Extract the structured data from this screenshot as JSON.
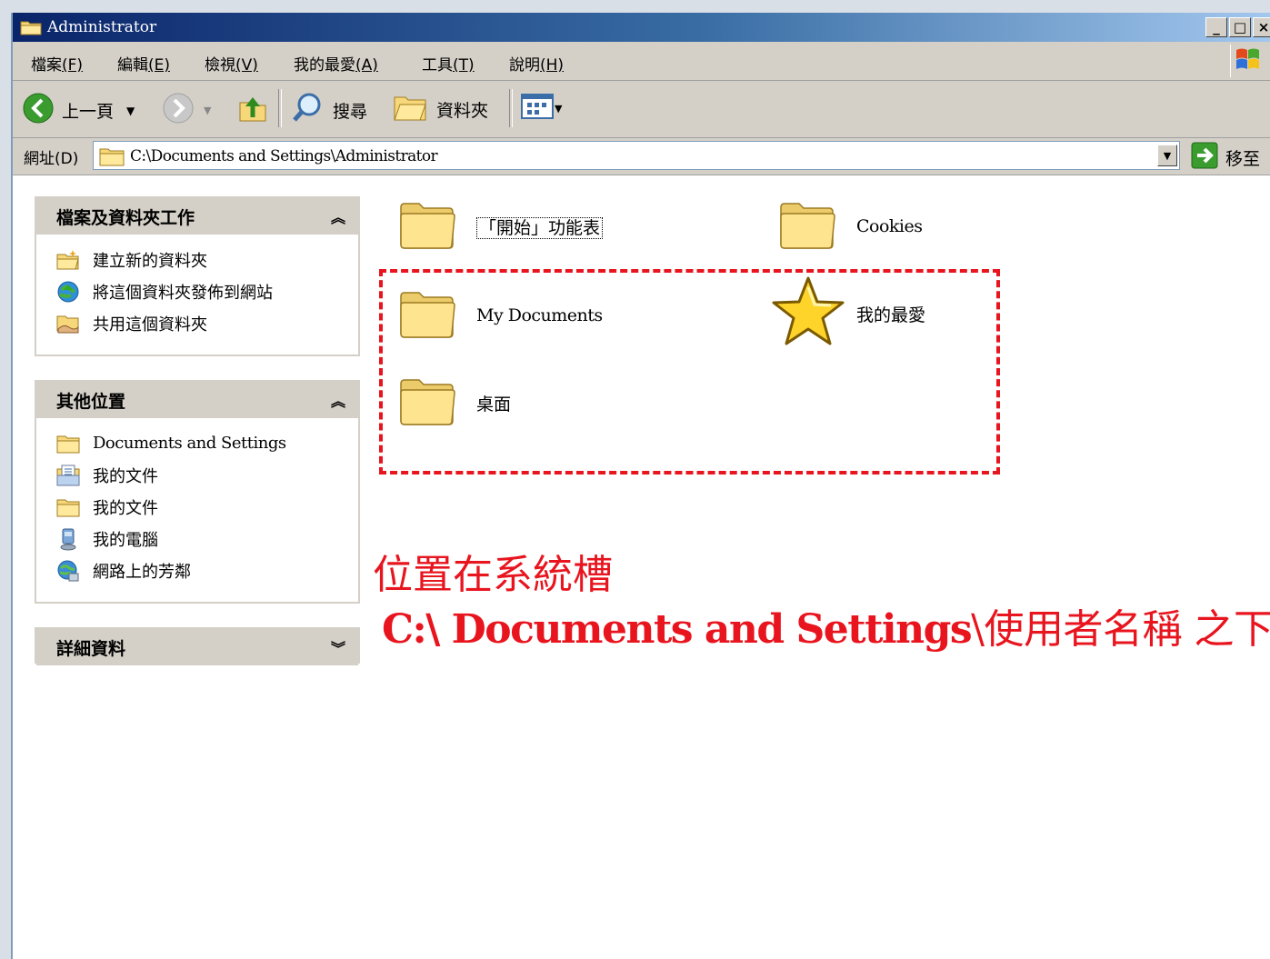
{
  "window": {
    "title": "Administrator"
  },
  "menu": [
    {
      "label": "檔案",
      "key": "(F)"
    },
    {
      "label": "編輯",
      "key": "(E)"
    },
    {
      "label": "檢視",
      "key": "(V)"
    },
    {
      "label": "我的最愛",
      "key": "(A)"
    },
    {
      "label": "工具",
      "key": "(T)"
    },
    {
      "label": "說明",
      "key": "(H)"
    }
  ],
  "toolbar": {
    "back": "上一頁",
    "search": "搜尋",
    "folders": "資料夾"
  },
  "address": {
    "label": "網址(D)",
    "path": "C:\\Documents and Settings\\Administrator",
    "go": "移至"
  },
  "tasks_panel": {
    "title": "檔案及資料夾工作",
    "items": [
      "建立新的資料夾",
      "將這個資料夾發佈到網站",
      "共用這個資料夾"
    ]
  },
  "places_panel": {
    "title": "其他位置",
    "items": [
      "Documents and Settings",
      "我的文件",
      "我的文件",
      "我的電腦",
      "網路上的芳鄰"
    ]
  },
  "details_panel": {
    "title": "詳細資料"
  },
  "files": [
    {
      "name": "「開始」功能表",
      "icon": "folder-icon"
    },
    {
      "name": "Cookies",
      "icon": "folder-icon"
    },
    {
      "name": "My Documents",
      "icon": "folder-icon"
    },
    {
      "name": "我的最愛",
      "icon": "star-icon"
    },
    {
      "name": "桌面",
      "icon": "folder-icon"
    }
  ],
  "annotation": {
    "line1": "位置在系統槽",
    "line2_bold": "C:\\ Documents and Settings",
    "line2_rest": "\\使用者名稱 之下"
  },
  "colors": {
    "annotation": "#e8141e",
    "title_bar": "#0a246a",
    "chrome": "#d4d0c8"
  }
}
